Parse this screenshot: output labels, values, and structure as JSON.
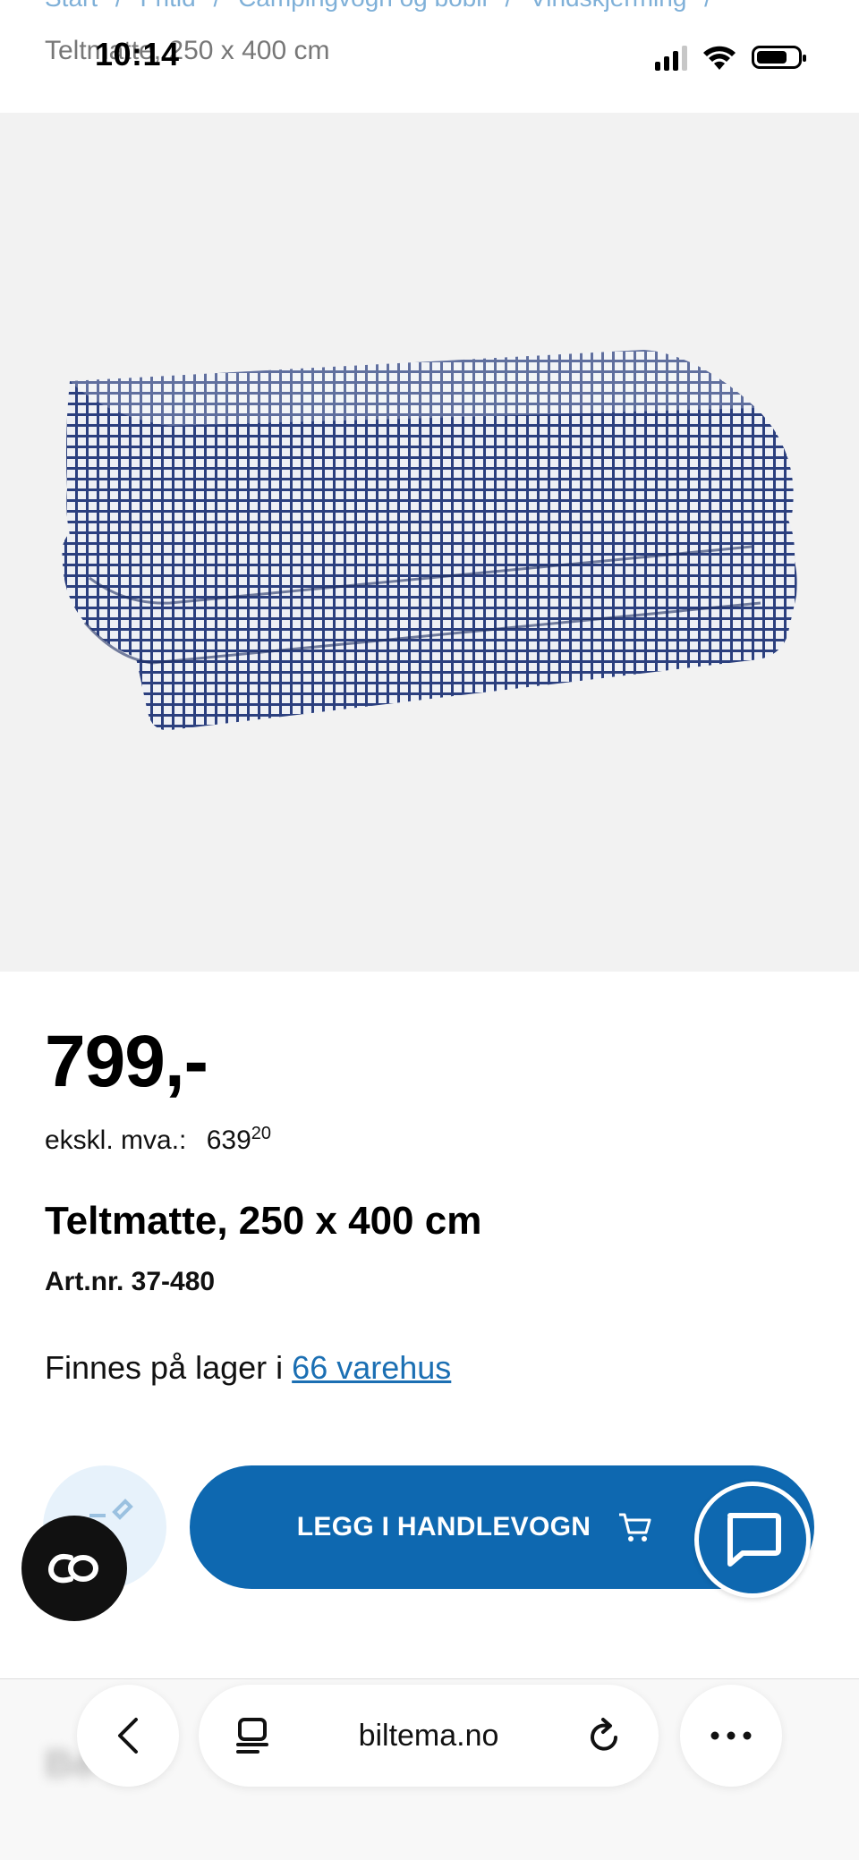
{
  "breadcrumb": {
    "items": [
      "Start",
      "/",
      "Fritid",
      "/",
      "Campingvogn og bobil",
      "/",
      "Vindskjerming",
      "/"
    ],
    "current": "Teltmatte, 250 x 400 cm"
  },
  "status_bar": {
    "time": "10:14",
    "icons": [
      "cellular-signal-icon",
      "wifi-icon",
      "battery-icon"
    ]
  },
  "product": {
    "image_alt": "folded blue and white grid tent mat",
    "price": "799,-",
    "vat_label": "ekskl. mva.:",
    "vat_value_main": "639",
    "vat_value_decimals": "20",
    "title": "Teltmatte, 250 x 400 cm",
    "article_number": "Art.nr. 37-480",
    "stock_prefix": "Finnes på lager i",
    "stock_link": "66 varehus"
  },
  "actions": {
    "add_to_cart_label": "LEGG I HANDLEVOGN",
    "note_icon": "edit-note-icon",
    "chat_icon": "chat-bubble-icon",
    "co_icon": "co-icon"
  },
  "browser": {
    "url": "biltema.no",
    "blurred_text": "Be           ve"
  },
  "colors": {
    "primary": "#0e68b0",
    "link": "#1b6fb3",
    "image_bg": "#f2f2f2"
  }
}
